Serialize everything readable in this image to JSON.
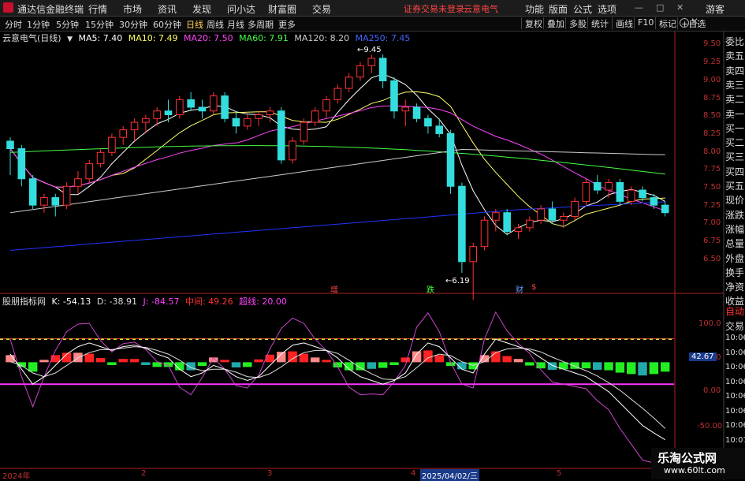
{
  "window": {
    "app_title": "通达信金融终端",
    "menus": [
      "行情",
      "市场",
      "资讯",
      "发现",
      "问小达",
      "财富圈",
      "交易"
    ],
    "warning": "证券交易未登录",
    "stock_header": "云意电气",
    "right_menus": [
      "功能",
      "版面",
      "公式",
      "选项"
    ],
    "user": "游客"
  },
  "tabs": {
    "periods": [
      "分时",
      "1分钟",
      "5分钟",
      "15分钟",
      "30分钟",
      "60分钟",
      "日线",
      "周线",
      "月线",
      "多周期",
      "更多"
    ],
    "active": "日线",
    "right_buttons": [
      "复权",
      "叠加",
      "多股",
      "统计",
      "画线",
      "F10",
      "标记",
      "+自选"
    ]
  },
  "info": {
    "stock": "云意电气(日线)",
    "ma5": "MA5: 7.40",
    "ma10": "MA10: 7.49",
    "ma20": "MA20: 7.50",
    "ma60": "MA60: 7.91",
    "ma120": "MA120: 8.20",
    "ma250": "MA250: 7.45"
  },
  "kdj": {
    "name": "股朋指标网",
    "k": "K: -54.13",
    "d": "D: -38.91",
    "j": "J: -84.57",
    "mid": "中间: 49.26",
    "line": "超线: 20.00"
  },
  "sidebar": [
    "委比",
    "卖五",
    "卖四",
    "卖三",
    "卖二",
    "卖一",
    "买一",
    "买二",
    "买三",
    "买四",
    "买五",
    "现价",
    "涨跌",
    "涨幅",
    "总量",
    "外盘",
    "换手",
    "净资",
    "收益"
  ],
  "sidebar2": [
    "自动",
    "交易",
    "10:06",
    "10:06",
    "10:06",
    "10:06",
    "10:06",
    "10:06",
    "10:06",
    "10:07"
  ],
  "yaxis_main": [
    "9.50",
    "9.25",
    "9.00",
    "8.75",
    "8.50",
    "8.25",
    "8.00",
    "7.75",
    "7.50",
    "7.25",
    "7.00",
    "6.75",
    "6.50"
  ],
  "yaxis_sub": [
    "100.0",
    "50.00",
    "0.00",
    "-50.00"
  ],
  "xaxis": [
    "2024年",
    "2",
    "3",
    "4",
    "5"
  ],
  "date_highlight": "2025/04/02/三",
  "price_tag": "42.67",
  "annotations": {
    "high": "9.45",
    "low": "6.19",
    "signals": [
      "增",
      "跌",
      "财",
      "$"
    ]
  },
  "watermark": {
    "title": "乐淘公式网",
    "url": "www.60lt.com"
  },
  "chart_data": {
    "type": "candlestick",
    "ylim": [
      6.3,
      9.65
    ],
    "candles": [
      [
        8.3,
        8.35,
        7.85,
        8.2
      ],
      [
        8.2,
        8.25,
        7.7,
        7.8
      ],
      [
        7.8,
        7.85,
        7.4,
        7.45
      ],
      [
        7.45,
        7.6,
        7.35,
        7.55
      ],
      [
        7.55,
        7.6,
        7.3,
        7.45
      ],
      [
        7.45,
        7.75,
        7.4,
        7.7
      ],
      [
        7.7,
        7.9,
        7.6,
        7.8
      ],
      [
        7.8,
        8.05,
        7.75,
        8.0
      ],
      [
        8.0,
        8.2,
        7.95,
        8.15
      ],
      [
        8.15,
        8.4,
        8.1,
        8.35
      ],
      [
        8.35,
        8.5,
        8.25,
        8.45
      ],
      [
        8.45,
        8.6,
        8.3,
        8.55
      ],
      [
        8.55,
        8.65,
        8.4,
        8.6
      ],
      [
        8.6,
        8.75,
        8.5,
        8.7
      ],
      [
        8.7,
        8.85,
        8.55,
        8.65
      ],
      [
        8.65,
        8.9,
        8.6,
        8.85
      ],
      [
        8.85,
        8.95,
        8.7,
        8.75
      ],
      [
        8.75,
        8.85,
        8.6,
        8.7
      ],
      [
        8.7,
        8.95,
        8.65,
        8.9
      ],
      [
        8.9,
        8.95,
        8.55,
        8.6
      ],
      [
        8.6,
        8.7,
        8.4,
        8.5
      ],
      [
        8.5,
        8.65,
        8.45,
        8.6
      ],
      [
        8.6,
        8.7,
        8.5,
        8.65
      ],
      [
        8.65,
        8.75,
        8.55,
        8.7
      ],
      [
        8.7,
        8.75,
        8.0,
        8.05
      ],
      [
        8.05,
        8.35,
        8.0,
        8.3
      ],
      [
        8.3,
        8.6,
        8.25,
        8.55
      ],
      [
        8.55,
        8.75,
        8.5,
        8.7
      ],
      [
        8.7,
        8.9,
        8.6,
        8.85
      ],
      [
        8.85,
        9.05,
        8.8,
        9.0
      ],
      [
        9.0,
        9.2,
        8.95,
        9.15
      ],
      [
        9.15,
        9.35,
        9.1,
        9.3
      ],
      [
        9.3,
        9.45,
        9.2,
        9.4
      ],
      [
        9.4,
        9.45,
        9.0,
        9.1
      ],
      [
        9.1,
        9.15,
        8.6,
        8.7
      ],
      [
        8.7,
        8.85,
        8.5,
        8.75
      ],
      [
        8.75,
        8.8,
        8.55,
        8.6
      ],
      [
        8.6,
        8.65,
        8.4,
        8.5
      ],
      [
        8.5,
        8.6,
        8.35,
        8.4
      ],
      [
        8.4,
        8.45,
        7.6,
        7.7
      ],
      [
        7.7,
        7.75,
        6.55,
        6.7
      ],
      [
        6.7,
        6.95,
        6.19,
        6.9
      ],
      [
        6.9,
        7.3,
        6.85,
        7.25
      ],
      [
        7.25,
        7.4,
        7.1,
        7.35
      ],
      [
        7.35,
        7.4,
        7.05,
        7.1
      ],
      [
        7.1,
        7.2,
        7.0,
        7.15
      ],
      [
        7.15,
        7.3,
        7.1,
        7.25
      ],
      [
        7.25,
        7.45,
        7.2,
        7.4
      ],
      [
        7.4,
        7.5,
        7.2,
        7.25
      ],
      [
        7.25,
        7.35,
        7.15,
        7.3
      ],
      [
        7.3,
        7.55,
        7.25,
        7.5
      ],
      [
        7.5,
        7.8,
        7.45,
        7.75
      ],
      [
        7.75,
        7.85,
        7.6,
        7.65
      ],
      [
        7.65,
        7.8,
        7.55,
        7.75
      ],
      [
        7.75,
        7.8,
        7.45,
        7.5
      ],
      [
        7.5,
        7.7,
        7.45,
        7.65
      ],
      [
        7.65,
        7.7,
        7.5,
        7.55
      ],
      [
        7.55,
        7.6,
        7.4,
        7.45
      ],
      [
        7.45,
        7.5,
        7.3,
        7.35
      ]
    ],
    "kdj_series": {
      "k": [
        60,
        40,
        20,
        30,
        45,
        60,
        70,
        75,
        70,
        65,
        70,
        72,
        68,
        60,
        55,
        40,
        30,
        35,
        45,
        40,
        30,
        25,
        30,
        45,
        60,
        72,
        75,
        70,
        65,
        55,
        40,
        30,
        25,
        20,
        25,
        35,
        60,
        75,
        70,
        55,
        40,
        35,
        60,
        80,
        75,
        70,
        65,
        55,
        45,
        40,
        35,
        30,
        20,
        10,
        -5,
        -20,
        -35,
        -45,
        -54
      ],
      "d": [
        50,
        45,
        35,
        30,
        35,
        45,
        55,
        62,
        66,
        66,
        68,
        70,
        69,
        65,
        60,
        52,
        42,
        38,
        40,
        40,
        36,
        30,
        29,
        34,
        43,
        54,
        62,
        65,
        65,
        61,
        52,
        42,
        34,
        27,
        26,
        30,
        42,
        55,
        60,
        58,
        50,
        45,
        50,
        62,
        67,
        68,
        67,
        63,
        56,
        50,
        44,
        38,
        31,
        22,
        12,
        0,
        -12,
        -25,
        -39
      ],
      "j": [
        80,
        30,
        -10,
        30,
        65,
        90,
        100,
        101,
        78,
        63,
        74,
        76,
        66,
        50,
        45,
        16,
        6,
        29,
        55,
        40,
        18,
        15,
        32,
        67,
        94,
        108,
        101,
        80,
        65,
        43,
        16,
        6,
        7,
        6,
        23,
        45,
        96,
        115,
        90,
        49,
        20,
        15,
        80,
        116,
        91,
        74,
        61,
        39,
        23,
        20,
        17,
        14,
        -2,
        -14,
        -39,
        -60,
        -81,
        -85,
        -85
      ],
      "mid": 49.26,
      "upper": 80,
      "lower": 20
    }
  }
}
